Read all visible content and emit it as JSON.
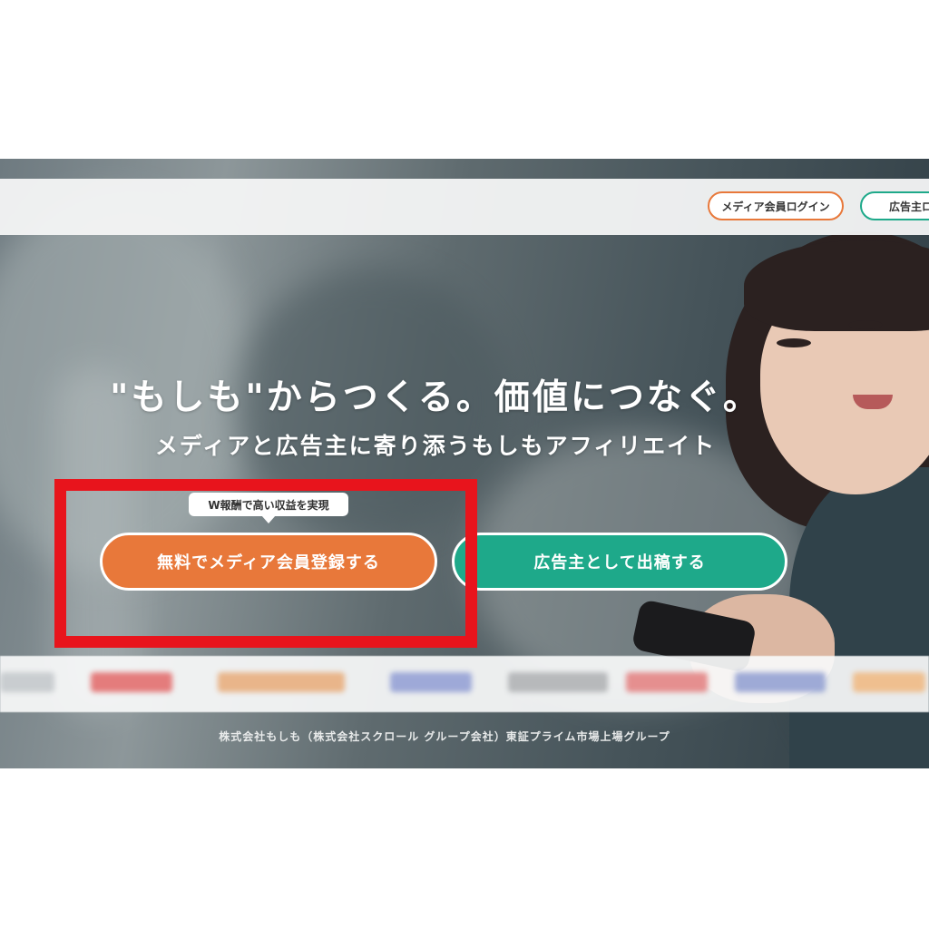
{
  "header": {
    "media_login": "メディア会員ログイン",
    "advertiser_login": "広告主ロ"
  },
  "hero": {
    "headline": "\"もしも\"からつくる。価値につなぐ。",
    "subheadline": "メディアと広告主に寄り添うもしもアフィリエイト",
    "balloon": "W報酬で高い収益を実現",
    "cta_media": "無料でメディア会員登録する",
    "cta_advertiser": "広告主として出稿する"
  },
  "footer": {
    "company": "株式会社もしも（株式会社スクロール グループ会社）東証プライム市場上場グループ"
  },
  "colors": {
    "media_orange": "#e8783a",
    "advertiser_green": "#1ea98a",
    "highlight_red": "#e8141c"
  }
}
